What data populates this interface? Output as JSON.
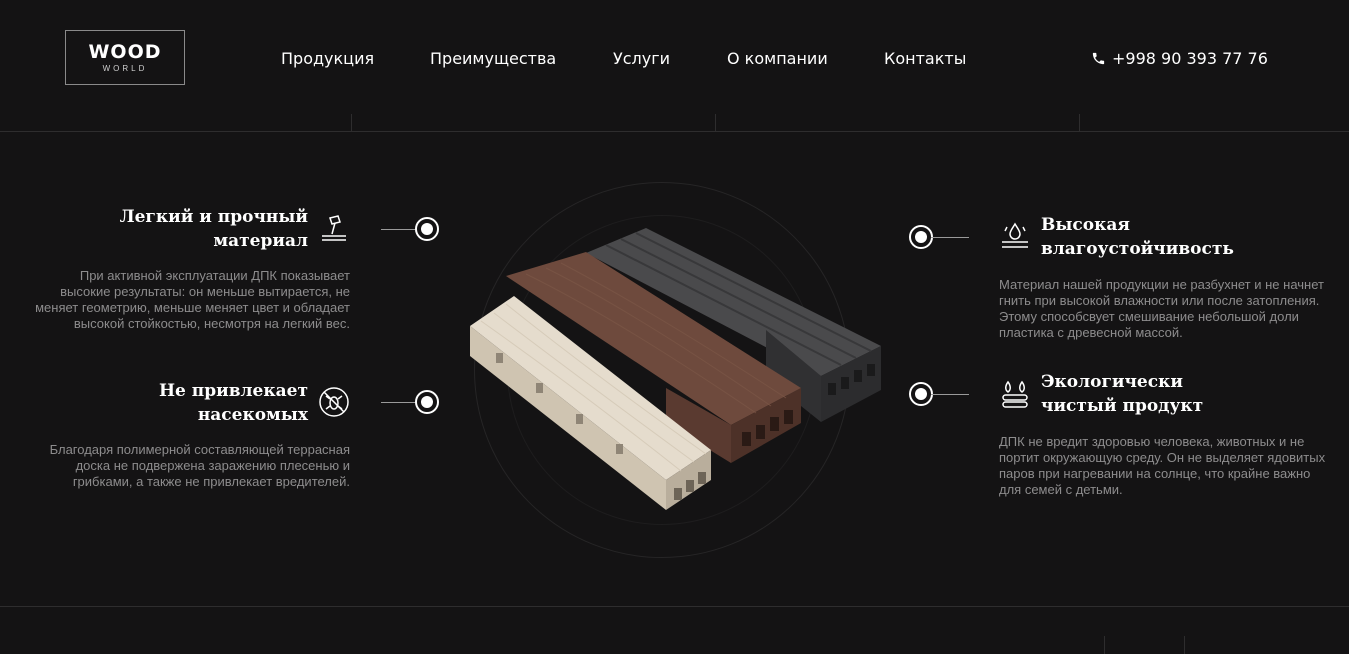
{
  "logo": {
    "main": "WOOD",
    "sub": "WORLD"
  },
  "nav": {
    "items": [
      {
        "label": "Продукция"
      },
      {
        "label": "Преимущества"
      },
      {
        "label": "Услуги"
      },
      {
        "label": "О компании"
      },
      {
        "label": "Контакты"
      }
    ]
  },
  "phone": {
    "number": "+998 90 393 77 76",
    "icon": "phone-icon"
  },
  "features": {
    "light": {
      "title_line1": "Легкий и прочный",
      "title_line2": "материал",
      "text": "При активной эксплуатации ДПК показывает высокие результаты: он меньше вытирается, не меняет геометрию, меньше меняет цвет и обладает высокой стойкостью, несмотря на легкий вес.",
      "icon": "hammer-icon"
    },
    "insects": {
      "title_line1": "Не привлекает",
      "title_line2": "насекомых",
      "text": "Благодаря полимерной составляющей террасная доска не подвержена заражению плесенью и грибками, а также не привлекает вредителей.",
      "icon": "no-bugs-icon"
    },
    "moisture": {
      "title_line1": "Высокая",
      "title_line2": "влагоустойчивость",
      "text": "Материал нашей продукции не разбухнет и не начнет гнить при высокой влажности или после затопления. Этому способсвует смешивание небольшой доли пластика с древесной массой.",
      "icon": "water-drops-icon"
    },
    "eco": {
      "title_line1": "Экологически",
      "title_line2": "чистый продукт",
      "text": "ДПК не вредит здоровью человека, животных и не портит окружающую среду. Он не выделяет ядовитых паров при нагревании на солнце, что крайне важно для семей с детьми.",
      "icon": "eco-logs-icon"
    }
  },
  "colors": {
    "background": "#141314",
    "text_muted": "#8d8c8d",
    "accent": "#ffffff"
  }
}
